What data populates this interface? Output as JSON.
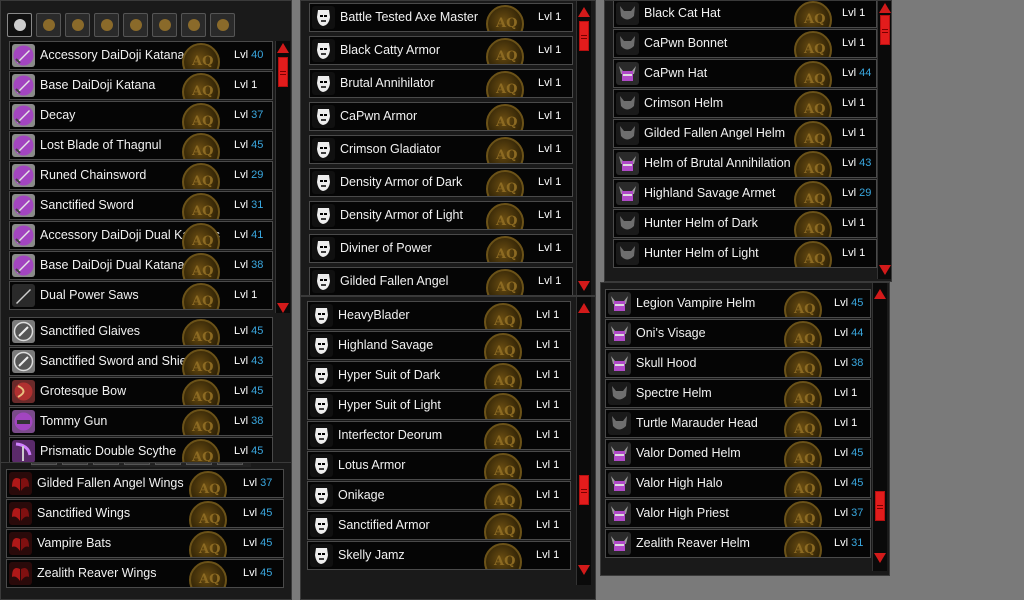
{
  "colors": {
    "accent_red": "#d21a1a",
    "level_blue": "#3aa8e0",
    "sword_purple": "#a245c0",
    "wing_red": "#b01818",
    "mask_white": "#eeeeee",
    "helm_gray": "#6e6e6e"
  },
  "category_tabs": [
    "sword-icon",
    "armor-icon",
    "helm-icon",
    "cape-icon",
    "pet-icon",
    "amulet-icon",
    "bag-icon",
    "food-icon"
  ],
  "level_label": "Lvl",
  "weapons": [
    {
      "name": "Accessory DaiDoji Katana",
      "level": "40",
      "member": true,
      "icon": "katana-icon"
    },
    {
      "name": "Base DaiDoji Katana",
      "level": "1",
      "member": false,
      "icon": "katana-icon"
    },
    {
      "name": "Decay",
      "level": "37",
      "member": true,
      "icon": "sword-icon"
    },
    {
      "name": "Lost Blade of Thagnul",
      "level": "45",
      "member": true,
      "icon": "sword-icon"
    },
    {
      "name": "Runed Chainsword",
      "level": "29",
      "member": true,
      "icon": "sword-icon"
    },
    {
      "name": "Sanctified Sword",
      "level": "31",
      "member": true,
      "icon": "sword-icon"
    },
    {
      "name": "Accessory DaiDoji Dual Katanas",
      "level": "41",
      "member": true,
      "icon": "katana-icon"
    },
    {
      "name": "Base DaiDoji Dual Katanas",
      "level": "38",
      "member": true,
      "icon": "katana-icon"
    },
    {
      "name": "Dual Power Saws",
      "level": "1",
      "member": false,
      "icon": "saw-icon"
    },
    {
      "name": "Sanctified Glaives",
      "level": "45",
      "member": true,
      "icon": "glaive-icon"
    },
    {
      "name": "Sanctified Sword and Shield",
      "level": "43",
      "member": true,
      "icon": "shield-icon"
    },
    {
      "name": "Grotesque Bow",
      "level": "45",
      "member": true,
      "icon": "bow-icon"
    },
    {
      "name": "Tommy Gun",
      "level": "38",
      "member": true,
      "icon": "gun-icon"
    },
    {
      "name": "Prismatic Double Scythe",
      "level": "45",
      "member": true,
      "icon": "scythe-icon"
    }
  ],
  "capes": [
    {
      "name": "Gilded Fallen Angel Wings",
      "level": "37",
      "member": true,
      "icon": "wings-icon"
    },
    {
      "name": "Sanctified Wings",
      "level": "45",
      "member": true,
      "icon": "wings-icon"
    },
    {
      "name": "Vampire Bats",
      "level": "45",
      "member": true,
      "icon": "wings-icon"
    },
    {
      "name": "Zealith Reaver Wings",
      "level": "45",
      "member": true,
      "icon": "wings-icon"
    }
  ],
  "armors_top": [
    {
      "name": "Battle Tested Axe Master",
      "level": "1",
      "member": false,
      "icon": "mask-icon"
    },
    {
      "name": "Black Catty Armor",
      "level": "1",
      "member": false,
      "icon": "mask-icon"
    },
    {
      "name": "Brutal Annihilator",
      "level": "1",
      "member": false,
      "icon": "mask-icon"
    },
    {
      "name": "CaPwn Armor",
      "level": "1",
      "member": false,
      "icon": "mask-icon"
    },
    {
      "name": "Crimson Gladiator",
      "level": "1",
      "member": false,
      "icon": "mask-icon"
    },
    {
      "name": "Density Armor of Dark",
      "level": "1",
      "member": false,
      "icon": "mask-icon"
    },
    {
      "name": "Density Armor of Light",
      "level": "1",
      "member": false,
      "icon": "mask-icon"
    },
    {
      "name": "Diviner of Power",
      "level": "1",
      "member": false,
      "icon": "mask-icon"
    },
    {
      "name": "Gilded Fallen Angel",
      "level": "1",
      "member": false,
      "icon": "mask-icon"
    }
  ],
  "armors_bottom": [
    {
      "name": "HeavyBlader",
      "level": "1",
      "member": false,
      "icon": "mask-icon"
    },
    {
      "name": "Highland Savage",
      "level": "1",
      "member": false,
      "icon": "mask-icon"
    },
    {
      "name": "Hyper Suit of Dark",
      "level": "1",
      "member": false,
      "icon": "mask-icon"
    },
    {
      "name": "Hyper Suit of Light",
      "level": "1",
      "member": false,
      "icon": "mask-icon"
    },
    {
      "name": "Interfector Deorum",
      "level": "1",
      "member": false,
      "icon": "mask-icon"
    },
    {
      "name": "Lotus Armor",
      "level": "1",
      "member": false,
      "icon": "mask-icon"
    },
    {
      "name": "Onikage",
      "level": "1",
      "member": false,
      "icon": "mask-icon"
    },
    {
      "name": "Sanctified Armor",
      "level": "1",
      "member": false,
      "icon": "mask-icon"
    },
    {
      "name": "Skelly Jamz",
      "level": "1",
      "member": false,
      "icon": "mask-icon"
    }
  ],
  "helms_top": [
    {
      "name": "Black Cat Hat",
      "level": "1",
      "member": false,
      "icon": "helm-icon"
    },
    {
      "name": "CaPwn Bonnet",
      "level": "1",
      "member": false,
      "icon": "helm-icon"
    },
    {
      "name": "CaPwn Hat",
      "level": "44",
      "member": true,
      "icon": "viking-helm-icon"
    },
    {
      "name": "Crimson Helm",
      "level": "1",
      "member": false,
      "icon": "helm-icon"
    },
    {
      "name": "Gilded Fallen Angel Helm",
      "level": "1",
      "member": false,
      "icon": "helm-icon"
    },
    {
      "name": "Helm of Brutal Annihilation",
      "level": "43",
      "member": true,
      "icon": "viking-helm-icon"
    },
    {
      "name": "Highland Savage Armet",
      "level": "29",
      "member": true,
      "icon": "viking-helm-icon"
    },
    {
      "name": "Hunter Helm of Dark",
      "level": "1",
      "member": false,
      "icon": "helm-icon"
    },
    {
      "name": "Hunter Helm of Light",
      "level": "1",
      "member": false,
      "icon": "helm-icon"
    }
  ],
  "helms_bottom": [
    {
      "name": "Legion Vampire Helm",
      "level": "45",
      "member": true,
      "icon": "viking-helm-icon"
    },
    {
      "name": "Oni's Visage",
      "level": "44",
      "member": true,
      "icon": "viking-helm-icon"
    },
    {
      "name": "Skull Hood",
      "level": "38",
      "member": true,
      "icon": "viking-helm-icon"
    },
    {
      "name": "Spectre Helm",
      "level": "1",
      "member": false,
      "icon": "helm-icon"
    },
    {
      "name": "Turtle Marauder Head",
      "level": "1",
      "member": false,
      "icon": "helm-icon"
    },
    {
      "name": "Valor Domed Helm",
      "level": "45",
      "member": true,
      "icon": "viking-helm-icon"
    },
    {
      "name": "Valor High Halo",
      "level": "45",
      "member": true,
      "icon": "viking-helm-icon"
    },
    {
      "name": "Valor High Priest",
      "level": "37",
      "member": true,
      "icon": "viking-helm-icon"
    },
    {
      "name": "Zealith Reaver Helm",
      "level": "31",
      "member": true,
      "icon": "viking-helm-icon"
    }
  ]
}
